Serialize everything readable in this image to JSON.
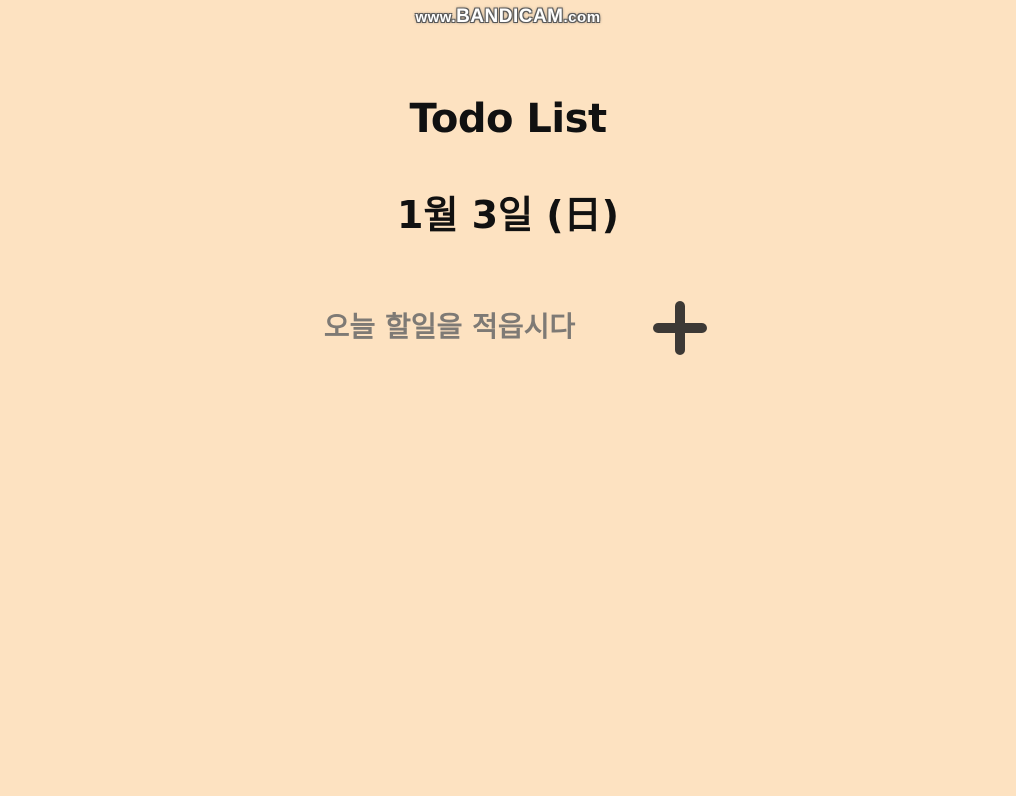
{
  "watermark": {
    "prefix": "www.",
    "brand": "BANDICAM",
    "suffix": ".com"
  },
  "header": {
    "title": "Todo List",
    "date": "1월 3일 (日)"
  },
  "todo_form": {
    "placeholder": "오늘 할일을 적읍시다",
    "add_icon": "plus-icon"
  },
  "colors": {
    "background": "#fde2c1",
    "text": "#111111",
    "placeholder": "#7e7a75",
    "icon": "#3d3935"
  }
}
